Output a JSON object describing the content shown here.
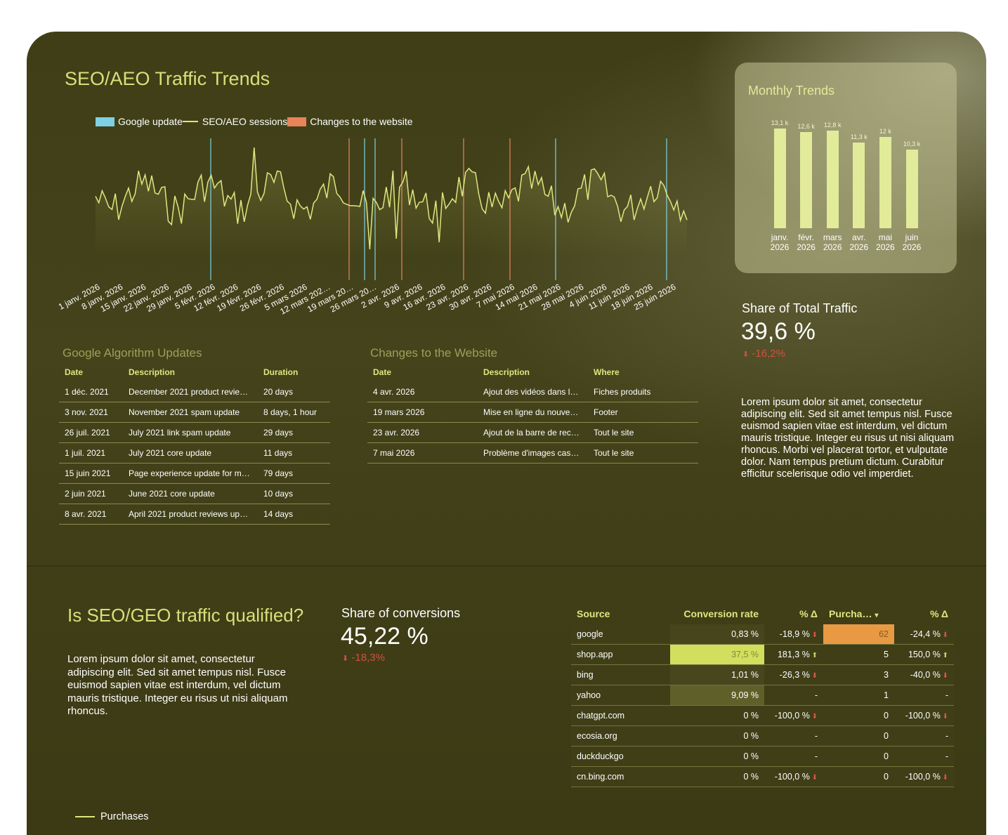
{
  "header": {
    "title": "SEO/AEO Traffic Trends"
  },
  "legend": {
    "google_update": "Google update",
    "sessions": "SEO/AEO sessions",
    "changes": "Changes to the website"
  },
  "colors": {
    "google_update": "#7fd0e3",
    "changes": "#e8835a",
    "sessions_line": "#dfe67e",
    "accent": "#d7e07a",
    "negative": "#d0523f"
  },
  "sessions_chart": {
    "x_ticks": [
      "1 janv. 2026",
      "8 janv. 2026",
      "15 janv. 2026",
      "22 janv. 2026",
      "29 janv. 2026",
      "5 févr. 2026",
      "12 févr. 2026",
      "19 févr. 2026",
      "26 févr. 2026",
      "5 mars 2026",
      "12 mars 202…",
      "19 mars 20…",
      "26 mars 20…",
      "2 avr. 2026",
      "9 avr. 2026",
      "16 avr. 2026",
      "23 avr. 2026",
      "30 avr. 2026",
      "7 mai 2026",
      "14 mai 2026",
      "21 mai 2026",
      "28 mai 2026",
      "4 juin 2026",
      "11 juin 2026",
      "18 juin 2026",
      "25 juin 2026"
    ]
  },
  "monthly": {
    "title": "Monthly Trends",
    "months": [
      {
        "line1": "janv.",
        "line2": "2026",
        "label": "13,1 k",
        "value": 13.1
      },
      {
        "line1": "févr.",
        "line2": "2026",
        "label": "12,6 k",
        "value": 12.6
      },
      {
        "line1": "mars",
        "line2": "2026",
        "label": "12,8 k",
        "value": 12.8
      },
      {
        "line1": "avr.",
        "line2": "2026",
        "label": "11,3 k",
        "value": 11.3
      },
      {
        "line1": "mai",
        "line2": "2026",
        "label": "12 k",
        "value": 12.0
      },
      {
        "line1": "juin",
        "line2": "2026",
        "label": "10,3 k",
        "value": 10.3
      }
    ]
  },
  "google_updates": {
    "title": "Google Algorithm Updates",
    "headers": [
      "Date",
      "Description",
      "Duration"
    ],
    "rows": [
      [
        "1 déc. 2021",
        "December 2021 product revie…",
        "20 days"
      ],
      [
        "3 nov. 2021",
        "November 2021 spam update",
        "8 days, 1 hour"
      ],
      [
        "26 juil. 2021",
        "July 2021 link spam update",
        "29 days"
      ],
      [
        "1 juil. 2021",
        "July 2021 core update",
        "11 days"
      ],
      [
        "15 juin 2021",
        "Page experience update for m…",
        "79 days"
      ],
      [
        "2 juin 2021",
        "June 2021 core update",
        "10 days"
      ],
      [
        "8 avr. 2021",
        "April 2021 product reviews up…",
        "14 days"
      ]
    ]
  },
  "site_changes": {
    "title": "Changes to the Website",
    "headers": [
      "Date",
      "Description",
      "Where"
    ],
    "rows": [
      [
        "4 avr. 2026",
        "Ajout des vidéos dans l…",
        "Fiches produits"
      ],
      [
        "19 mars 2026",
        "Mise en ligne du nouve…",
        "Footer"
      ],
      [
        "23 avr. 2026",
        "Ajout de la barre de rec…",
        "Tout le site"
      ],
      [
        "7 mai 2026",
        "Problème d'images cas…",
        "Tout le site"
      ]
    ]
  },
  "share_traffic": {
    "label": "Share of Total Traffic",
    "value": "39,6 %",
    "delta": "-16,2%",
    "arrow": "⬇"
  },
  "lorem_1": "Lorem ipsum dolor sit amet, consectetur adipiscing elit. Sed sit amet tempus nisl. Fusce euismod sapien vitae est interdum, vel dictum mauris tristique. Integer eu risus ut nisi aliquam rhoncus. Morbi vel placerat tortor, et vulputate dolor. Nam tempus pretium dictum. Curabitur efficitur scelerisque odio vel imperdiet.",
  "qualified": {
    "title": "Is SEO/GEO traffic qualified?",
    "text": "Lorem ipsum dolor sit amet, consectetur adipiscing elit. Sed sit amet tempus nisl. Fusce euismod sapien vitae est interdum, vel dictum mauris tristique. Integer eu risus ut nisi aliquam rhoncus."
  },
  "share_conv": {
    "label": "Share of conversions",
    "value": "45,22 %",
    "delta": "-18,3%",
    "arrow": "⬇"
  },
  "conv_table": {
    "headers": [
      "Source",
      "Conversion rate",
      "% Δ",
      "Purcha…",
      "% Δ"
    ],
    "sort_icon": "▾",
    "rows": [
      {
        "source": "google",
        "rate": "0,83 %",
        "rate_d": "-18,9 %",
        "rate_dir": "down",
        "purch": "62",
        "purch_d": "-24,4 %",
        "purch_dir": "down",
        "rate_bg": "#46451c",
        "purch_bg": "#e89a43"
      },
      {
        "source": "shop.app",
        "rate": "37,5 %",
        "rate_d": "181,3 %",
        "rate_dir": "up",
        "purch": "5",
        "purch_d": "150,0 %",
        "purch_dir": "up",
        "rate_bg": "#d2de5e",
        "purch_bg": "#3f3e17"
      },
      {
        "source": "bing",
        "rate": "1,01 %",
        "rate_d": "-26,3 %",
        "rate_dir": "down",
        "purch": "3",
        "purch_d": "-40,0 %",
        "purch_dir": "down",
        "rate_bg": "#47461d",
        "purch_bg": "#3f3e17"
      },
      {
        "source": "yahoo",
        "rate": "9,09 %",
        "rate_d": "-",
        "rate_dir": "",
        "purch": "1",
        "purch_d": "-",
        "purch_dir": "",
        "rate_bg": "#5f6029",
        "purch_bg": "#3f3e17"
      },
      {
        "source": "chatgpt.com",
        "rate": "0 %",
        "rate_d": "-100,0 %",
        "rate_dir": "down",
        "purch": "0",
        "purch_d": "-100,0 %",
        "purch_dir": "down",
        "rate_bg": "#3f3e17",
        "purch_bg": "#3f3e17"
      },
      {
        "source": "ecosia.org",
        "rate": "0 %",
        "rate_d": "-",
        "rate_dir": "",
        "purch": "0",
        "purch_d": "-",
        "purch_dir": "",
        "rate_bg": "#3f3e17",
        "purch_bg": "#3f3e17"
      },
      {
        "source": "duckduckgo",
        "rate": "0 %",
        "rate_d": "-",
        "rate_dir": "",
        "purch": "0",
        "purch_d": "-",
        "purch_dir": "",
        "rate_bg": "#3f3e17",
        "purch_bg": "#3f3e17"
      },
      {
        "source": "cn.bing.com",
        "rate": "0 %",
        "rate_d": "-100,0 %",
        "rate_dir": "down",
        "purch": "0",
        "purch_d": "-100,0 %",
        "purch_dir": "down",
        "rate_bg": "#3f3e17",
        "purch_bg": "#3f3e17"
      }
    ]
  },
  "bottom_legend": {
    "purchases": "Purchases"
  }
}
